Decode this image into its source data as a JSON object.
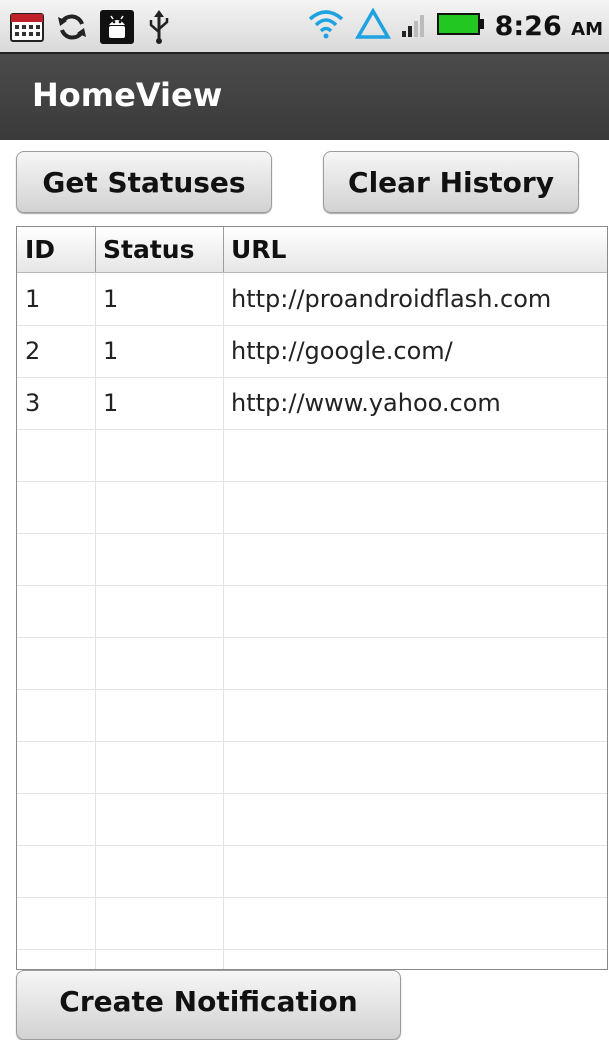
{
  "status_bar": {
    "icons": [
      "calendar-icon",
      "sync-icon",
      "android-debug-icon",
      "usb-icon",
      "wifi-icon",
      "data-transfer-icon",
      "signal-icon",
      "battery-icon"
    ],
    "time": "8:26",
    "ampm": "AM"
  },
  "title_bar": {
    "title": "HomeView"
  },
  "buttons": {
    "get_statuses": "Get Statuses",
    "clear_history": "Clear History",
    "create_notification": "Create Notification"
  },
  "table": {
    "columns": [
      "ID",
      "Status",
      "URL"
    ],
    "rows": [
      [
        "1",
        "1",
        "http://proandroidflash.com"
      ],
      [
        "2",
        "1",
        "http://google.com/"
      ],
      [
        "3",
        "1",
        "http://www.yahoo.com"
      ]
    ],
    "empty_rows": 11
  },
  "colors": {
    "title_bar_bg": "#3f3f3f",
    "title_text": "#ffffff",
    "wifi": "#1fa3e0",
    "battery": "#22c722"
  }
}
